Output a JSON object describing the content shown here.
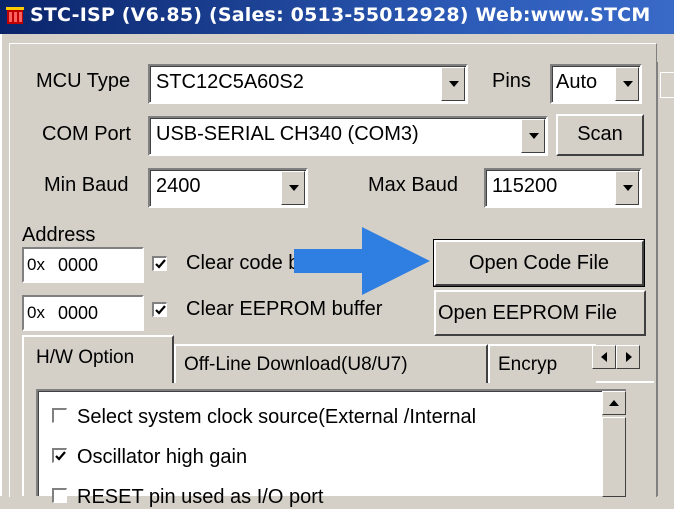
{
  "window": {
    "title": "STC-ISP (V6.85) (Sales: 0513-55012928) Web:www.STCM",
    "title_bar_color": "#0a246a"
  },
  "mcu": {
    "label": "MCU Type",
    "value": "STC12C5A60S2"
  },
  "pins": {
    "label": "Pins",
    "value": "Auto"
  },
  "com_port": {
    "label": "COM Port",
    "value": "USB-SERIAL CH340 (COM3)",
    "scan_label": "Scan"
  },
  "baud": {
    "min_label": "Min Baud",
    "min_value": "2400",
    "max_label": "Max Baud",
    "max_value": "115200"
  },
  "address": {
    "label": "Address",
    "prefix1": "0x",
    "code_addr": "0000",
    "clear_code_label": "Clear code buffer",
    "clear_code_checked": true,
    "prefix2": "0x",
    "eeprom_addr": "0000",
    "clear_eeprom_label": "Clear EEPROM buffer",
    "clear_eeprom_checked": true
  },
  "buttons": {
    "open_code": "Open Code File",
    "open_eeprom": "Open EEPROM File"
  },
  "annotation_arrow_color": "#2f7fe3",
  "tabs": [
    "H/W Option",
    "Off-Line Download(U8/U7)",
    "Encryp"
  ],
  "options": [
    {
      "label": "Select system clock source(External /Internal",
      "checked": false
    },
    {
      "label": "Oscillator high gain",
      "checked": true
    },
    {
      "label": "RESET pin used as I/O port",
      "checked": false
    }
  ]
}
